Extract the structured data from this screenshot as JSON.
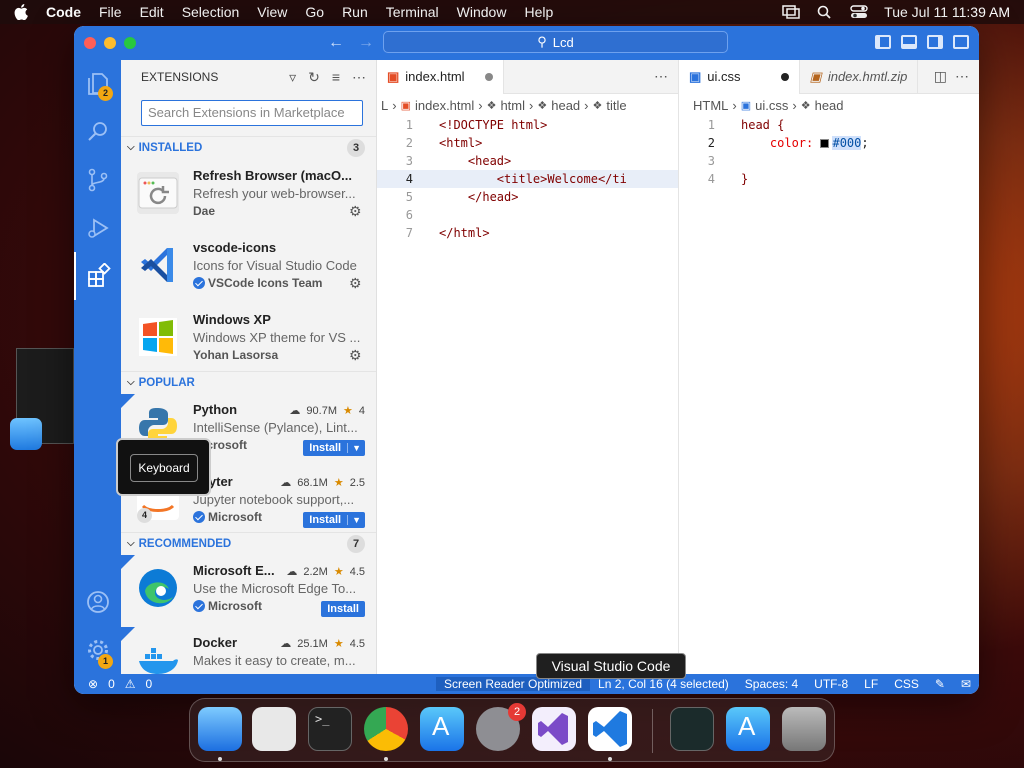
{
  "menubar": {
    "items": [
      "Code",
      "File",
      "Edit",
      "Selection",
      "View",
      "Go",
      "Run",
      "Terminal",
      "Window",
      "Help"
    ],
    "clock": "Tue Jul 11  11:39 AM"
  },
  "window": {
    "command_center": "Lcd"
  },
  "activity": {
    "explorer_badge": "2",
    "settings_badge": "1"
  },
  "sidebar": {
    "title": "EXTENSIONS",
    "search_placeholder": "Search Extensions in Marketplace",
    "installed": {
      "label": "INSTALLED",
      "count": "3",
      "items": [
        {
          "name": "Refresh Browser (macO...",
          "desc": "Refresh your web-browser...",
          "publisher": "Dae"
        },
        {
          "name": "vscode-icons",
          "desc": "Icons for Visual Studio Code",
          "publisher": "VSCode Icons Team"
        },
        {
          "name": "Windows XP",
          "desc": "Windows XP theme for VS ...",
          "publisher": "Yohan Lasorsa"
        }
      ]
    },
    "popular": {
      "label": "POPULAR",
      "items": [
        {
          "name": "Python",
          "downloads": "90.7M",
          "rating": "4",
          "desc": "IntelliSense (Pylance), Lint...",
          "publisher": "Microsoft",
          "install": "Install"
        },
        {
          "name": "upyter",
          "downloads": "68.1M",
          "rating": "2.5",
          "desc": "Jupyter notebook support,...",
          "publisher": "Microsoft",
          "install": "Install",
          "icon_badge": "4"
        }
      ]
    },
    "recommended": {
      "label": "RECOMMENDED",
      "count": "7",
      "items": [
        {
          "name": "Microsoft E...",
          "downloads": "2.2M",
          "rating": "4.5",
          "desc": "Use the Microsoft Edge To...",
          "publisher": "Microsoft",
          "install": "Install"
        },
        {
          "name": "Docker",
          "downloads": "25.1M",
          "rating": "4.5",
          "desc": "Makes it easy to create, m..."
        }
      ]
    }
  },
  "editor1": {
    "tab": "index.html",
    "crumbs": [
      "L",
      "index.html",
      "html",
      "head",
      "title"
    ],
    "lines": [
      {
        "n": "1",
        "code": "<!DOCTYPE html>"
      },
      {
        "n": "2",
        "code": "<html>"
      },
      {
        "n": "3",
        "code": "    <head>"
      },
      {
        "n": "4",
        "code": "        <title>Welcome</ti"
      },
      {
        "n": "5",
        "code": "    </head>"
      },
      {
        "n": "6",
        "code": ""
      },
      {
        "n": "7",
        "code": "</html>"
      }
    ]
  },
  "editor2": {
    "tab": "ui.css",
    "tab2": "index.hmtl.zip",
    "crumbs": [
      "HTML",
      "ui.css",
      "head"
    ],
    "lines": [
      {
        "n": "1",
        "code": "head {"
      },
      {
        "n": "2",
        "code": "    color: ",
        "value": "#000",
        "end": ";"
      },
      {
        "n": "3",
        "code": ""
      },
      {
        "n": "4",
        "code": "}"
      }
    ]
  },
  "statusbar": {
    "errors": "0",
    "warnings": "0",
    "screen_reader": "Screen Reader Optimized",
    "position": "Ln 2, Col 16 (4 selected)",
    "spaces": "Spaces: 4",
    "encoding": "UTF-8",
    "eol": "LF",
    "language": "CSS"
  },
  "overlays": {
    "keyboard_tooltip": "Keyboard",
    "dock_tooltip": "Visual Studio Code"
  },
  "dock": {
    "settings_badge": "2"
  }
}
